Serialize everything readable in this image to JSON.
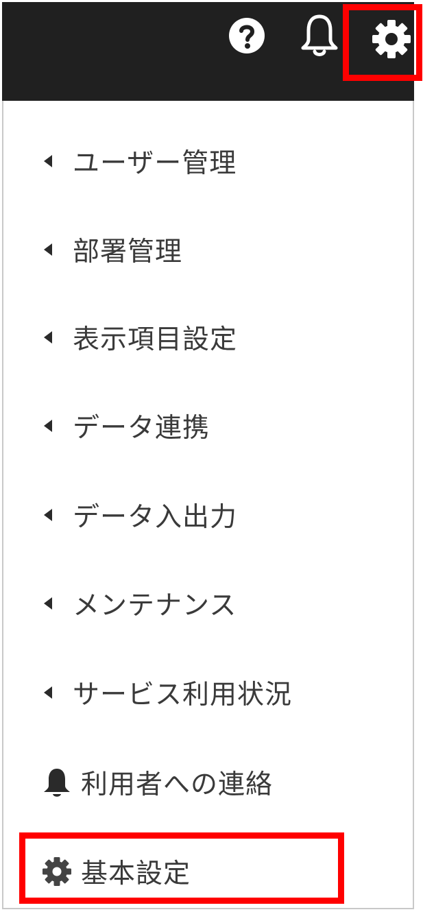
{
  "header": {
    "help_icon": "help-circle-icon",
    "notification_icon": "bell-icon",
    "settings_icon": "gear-icon"
  },
  "menu": {
    "items": [
      {
        "label": "ユーザー管理",
        "icon": "caret-left-icon"
      },
      {
        "label": "部署管理",
        "icon": "caret-left-icon"
      },
      {
        "label": "表示項目設定",
        "icon": "caret-left-icon"
      },
      {
        "label": "データ連携",
        "icon": "caret-left-icon"
      },
      {
        "label": "データ入出力",
        "icon": "caret-left-icon"
      },
      {
        "label": "メンテナンス",
        "icon": "caret-left-icon"
      },
      {
        "label": "サービス利用状況",
        "icon": "caret-left-icon"
      },
      {
        "label": "利用者への連絡",
        "icon": "bell-icon"
      },
      {
        "label": "基本設定",
        "icon": "gear-icon"
      }
    ]
  },
  "colors": {
    "header_bg": "#202020",
    "highlight": "#ff0000",
    "text": "#3a3a3a"
  }
}
